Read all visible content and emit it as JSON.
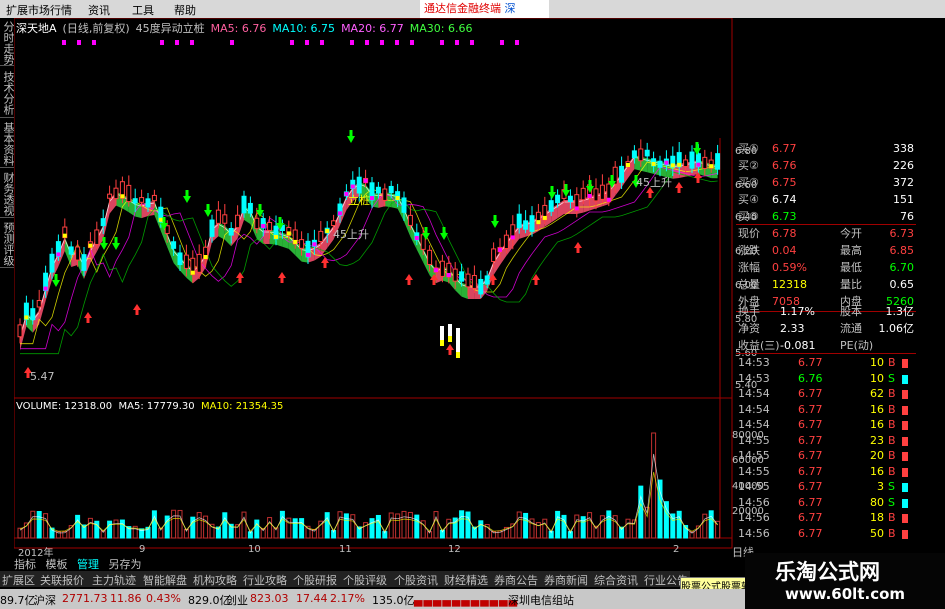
{
  "menu": {
    "items": [
      "扩展市场行情",
      "资讯",
      "工具",
      "帮助"
    ],
    "ticker": "通达信金融终端",
    "ticker_tail": "深"
  },
  "vtabs": [
    "分时走势",
    "技术分析",
    "基本资料",
    "财务透视",
    "预测评级"
  ],
  "header": {
    "stock": "深天地A",
    "mode": "(日线,前复权)",
    "indicator": "45度异动立桩",
    "ma5": "MA5: 6.76",
    "ma10": "MA10: 6.75",
    "ma20": "MA20: 6.77",
    "ma30": "MA30: 6.66"
  },
  "colors": {
    "ma5": "#ffffff",
    "ma10": "#ffff00",
    "ma20": "#ff00ff",
    "ma30": "#00ff00",
    "up": "#ff3030",
    "down": "#00ffff",
    "ribbon_up": "#ff5070",
    "ribbon_down": "#30d040"
  },
  "price_axis": [
    "6.80",
    "6.60",
    "6.40",
    "6.20",
    "6.00",
    "5.80",
    "5.60",
    "5.40"
  ],
  "vol_axis": [
    "80000",
    "60000",
    "40000",
    "20000"
  ],
  "annotations": {
    "low": "5.47",
    "a1": "45上升",
    "a2": "45上升",
    "a3": "立桩"
  },
  "volume_header": {
    "vol": "VOLUME: 12318.00",
    "ma5": "MA5: 17779.30",
    "ma10": "MA10: 21354.35"
  },
  "months": [
    "2012年",
    "9",
    "10",
    "11",
    "12",
    "2"
  ],
  "orderbook": [
    {
      "label": "买①",
      "price": "6.77",
      "vol": "338"
    },
    {
      "label": "买②",
      "price": "6.76",
      "vol": "226"
    },
    {
      "label": "买③",
      "price": "6.75",
      "vol": "372"
    },
    {
      "label": "买④",
      "price": "6.74",
      "vol": "151"
    },
    {
      "label": "买⑤",
      "price": "6.73",
      "vol": "76"
    }
  ],
  "quote": [
    {
      "l1": "现价",
      "v1": "6.78",
      "l2": "今开",
      "v2": "6.73"
    },
    {
      "l1": "涨跌",
      "v1": "0.04",
      "l2": "最高",
      "v2": "6.85"
    },
    {
      "l1": "涨幅",
      "v1": "0.59%",
      "l2": "最低",
      "v2": "6.70"
    },
    {
      "l1": "总量",
      "v1": "12318",
      "l2": "量比",
      "v2": "0.65"
    },
    {
      "l1": "外盘",
      "v1": "7058",
      "l2": "内盘",
      "v2": "5260"
    }
  ],
  "fund": [
    {
      "l1": "换手",
      "v1": "1.17%",
      "l2": "股本",
      "v2": "1.3亿"
    },
    {
      "l1": "净资",
      "v1": "2.33",
      "l2": "流通",
      "v2": "1.06亿"
    },
    {
      "l1": "收益(三)",
      "v1": "-0.081",
      "l2": "PE(动)",
      "v2": ""
    }
  ],
  "ticks": [
    {
      "t": "14:53",
      "p": "6.77",
      "v": "10",
      "d": "B"
    },
    {
      "t": "14:53",
      "p": "6.76",
      "v": "10",
      "d": "S"
    },
    {
      "t": "14:54",
      "p": "6.77",
      "v": "62",
      "d": "B"
    },
    {
      "t": "14:54",
      "p": "6.77",
      "v": "16",
      "d": "B"
    },
    {
      "t": "14:54",
      "p": "6.77",
      "v": "16",
      "d": "B"
    },
    {
      "t": "14:55",
      "p": "6.77",
      "v": "23",
      "d": "B"
    },
    {
      "t": "14:55",
      "p": "6.77",
      "v": "20",
      "d": "B"
    },
    {
      "t": "14:55",
      "p": "6.77",
      "v": "16",
      "d": "B"
    },
    {
      "t": "14:55",
      "p": "6.77",
      "v": "3",
      "d": "S"
    },
    {
      "t": "14:56",
      "p": "6.77",
      "v": "80",
      "d": "S"
    },
    {
      "t": "14:56",
      "p": "6.77",
      "v": "18",
      "d": "B"
    },
    {
      "t": "14:56",
      "p": "6.77",
      "v": "50",
      "d": "B"
    }
  ],
  "bottom_tabs": [
    "指标",
    "模板",
    "管理",
    "另存为"
  ],
  "period_label": "日线",
  "toolbar": [
    "扩展区",
    "关联报价",
    "主力轨迹",
    "智能解盘",
    "机构攻略",
    "行业攻略",
    "个股研报",
    "个股评级",
    "个股资讯",
    "财经精选",
    "券商公告",
    "券商新闻",
    "综合资讯",
    "行业公告"
  ],
  "tooltip": "股票公式股票软件",
  "status": {
    "s1": "89.7亿",
    "s2": "沪深",
    "s3": "2771.73",
    "s4": "11.86",
    "s5": "0.43%",
    "s6": "829.0亿",
    "s7": "创业",
    "s8": "823.03",
    "s9": "17.44",
    "s10": "2.17%",
    "s11": "135.0亿",
    "s12": "深圳电信组站"
  },
  "brand": {
    "name": "乐淘公式网",
    "url": "www.60lt.com"
  }
}
